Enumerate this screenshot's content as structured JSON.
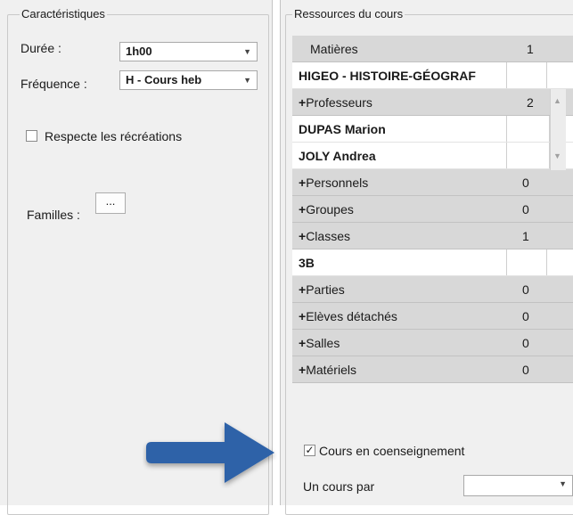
{
  "characteristics": {
    "legend": "Caractéristiques",
    "duree_label": "Durée :",
    "duree_value": "1h00",
    "frequence_label": "Fréquence :",
    "frequence_value": "H - Cours heb",
    "recreations_label": "Respecte les récréations",
    "recreations_checked": false,
    "familles_label": "Familles :",
    "familles_button": "..."
  },
  "resources": {
    "legend": "Ressources du cours",
    "rows": [
      {
        "type": "cat",
        "plus": "",
        "name": "Matières",
        "count": "1"
      },
      {
        "type": "item",
        "name": "HIGEO - HISTOIRE-GÉOGRAF"
      },
      {
        "type": "cat",
        "plus": "+",
        "name": "Professeurs",
        "count": "2"
      },
      {
        "type": "item",
        "name": "DUPAS Marion"
      },
      {
        "type": "item",
        "name": "JOLY Andrea"
      },
      {
        "type": "cat",
        "plus": "+",
        "name": "Personnels",
        "count": "0"
      },
      {
        "type": "cat",
        "plus": "+",
        "name": "Groupes",
        "count": "0"
      },
      {
        "type": "cat",
        "plus": "+",
        "name": "Classes",
        "count": "1"
      },
      {
        "type": "item",
        "name": "3B"
      },
      {
        "type": "cat",
        "plus": "+",
        "name": "Parties",
        "count": "0"
      },
      {
        "type": "cat",
        "plus": "+",
        "name": "Elèves détachés",
        "count": "0"
      },
      {
        "type": "cat",
        "plus": "+",
        "name": "Salles",
        "count": "0"
      },
      {
        "type": "cat",
        "plus": "+",
        "name": "Matériels",
        "count": "0"
      }
    ],
    "coens_label": "Cours en coenseignement",
    "coens_checked": true,
    "cours_par_label": "Un cours par",
    "cours_par_value": ""
  },
  "colors": {
    "arrow": "#2e62a8",
    "panel": "#f0f0f0",
    "category_row": "#d8d8d8"
  },
  "icons": {
    "dropdown": "chevron-down-icon",
    "checkmark": "checkmark-icon",
    "pointer_arrow": "arrow-right-icon"
  }
}
